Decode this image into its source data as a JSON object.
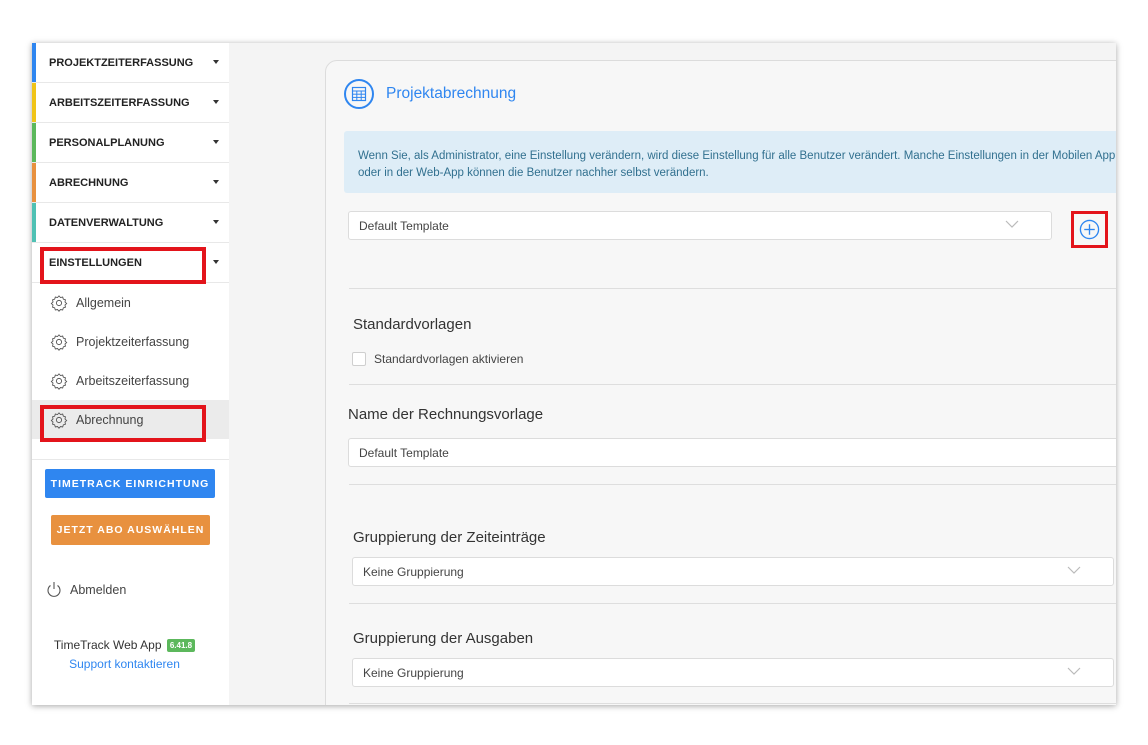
{
  "sidebar": {
    "nav_items": [
      {
        "label": "PROJEKTZEITERFASSUNG",
        "color": "#2f86f0"
      },
      {
        "label": "ARBEITSZEITERFASSUNG",
        "color": "#f0c419"
      },
      {
        "label": "PERSONALPLANUNG",
        "color": "#5cb85c"
      },
      {
        "label": "ABRECHNUNG",
        "color": "#e8913f"
      },
      {
        "label": "DATENVERWALTUNG",
        "color": "#4fc1b4"
      },
      {
        "label": "EINSTELLUNGEN",
        "color": "#ffffff"
      }
    ],
    "sub_items": [
      {
        "label": "Allgemein",
        "icon": "gear-icon"
      },
      {
        "label": "Projektzeiterfassung",
        "icon": "gear-icon"
      },
      {
        "label": "Arbeitszeiterfassung",
        "icon": "gear-icon"
      },
      {
        "label": "Abrechnung",
        "icon": "gear-icon",
        "active": true
      }
    ],
    "setup_button": "TIMETRACK EINRICHTUNG",
    "subscribe_button": "JETZT ABO AUSWÄHLEN",
    "logout": "Abmelden",
    "app_name": "TimeTrack Web App",
    "version": "6.41.8",
    "support": "Support kontaktieren"
  },
  "main": {
    "title": "Projektabrechnung",
    "info_text": "Wenn Sie, als Administrator, eine Einstellung verändern, wird diese Einstellung für alle Benutzer verändert. Manche Einstellungen in der Mobilen App oder in der Web-App können die Benutzer nachher selbst verändern.",
    "template_select": "Default Template",
    "standard_templates": {
      "title": "Standardvorlagen",
      "checkbox_label": "Standardvorlagen aktivieren",
      "checked": false
    },
    "template_name": {
      "title": "Name der Rechnungsvorlage",
      "value": "Default Template"
    },
    "time_grouping": {
      "title": "Gruppierung der Zeiteinträge",
      "value": "Keine Gruppierung"
    },
    "expense_grouping": {
      "title": "Gruppierung der Ausgaben",
      "value": "Keine Gruppierung"
    }
  },
  "colors": {
    "accent": "#2f86f0",
    "highlight": "#e3141b",
    "orange": "#e8913f"
  }
}
